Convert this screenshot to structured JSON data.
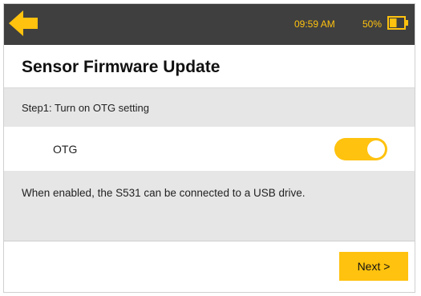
{
  "status_bar": {
    "back_icon": "arrow-left-icon",
    "time": "09:59 AM",
    "battery_percent": "50%",
    "battery_level": 0.5,
    "battery_icon": "battery-icon",
    "accent_color": "#ffc20e",
    "bar_color": "#3f3f3f"
  },
  "header": {
    "title": "Sensor Firmware Update"
  },
  "step": {
    "label": "Step1: Turn on OTG setting"
  },
  "otg": {
    "label": "OTG",
    "enabled": true
  },
  "info": {
    "text": "When enabled, the S531 can be connected to a USB drive."
  },
  "footer": {
    "next_label": "Next >"
  }
}
